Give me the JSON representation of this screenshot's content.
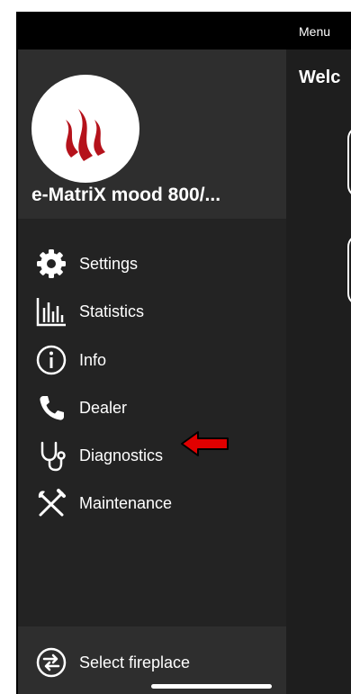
{
  "header": {
    "menu_label": "Menu"
  },
  "drawer": {
    "device_name": "e-MatriX mood 800/...",
    "items": [
      {
        "label": "Settings",
        "icon": "gear-icon"
      },
      {
        "label": "Statistics",
        "icon": "bar-chart-icon"
      },
      {
        "label": "Info",
        "icon": "info-icon"
      },
      {
        "label": "Dealer",
        "icon": "phone-icon"
      },
      {
        "label": "Diagnostics",
        "icon": "stethoscope-icon"
      },
      {
        "label": "Maintenance",
        "icon": "tools-icon"
      }
    ],
    "footer": {
      "label": "Select fireplace",
      "icon": "swap-icon"
    }
  },
  "main": {
    "title": "Welc"
  },
  "colors": {
    "drawer_bg": "#232323",
    "header_bg": "#2e2e2e",
    "logo_flame": "#b5121b",
    "annotation_arrow": "#e00000"
  }
}
